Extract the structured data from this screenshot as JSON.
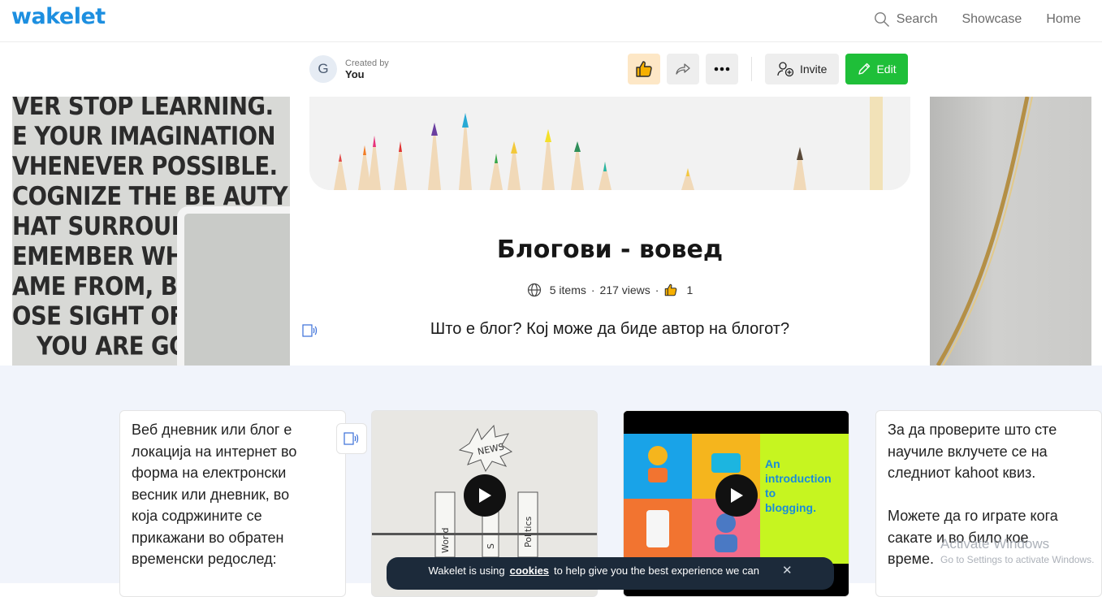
{
  "brand": {
    "logo": "wakelet",
    "color": "#1d8fe0"
  },
  "nav": {
    "search": "Search",
    "showcase": "Showcase",
    "home": "Home"
  },
  "creator": {
    "initial": "G",
    "created_by": "Created by",
    "name": "You"
  },
  "actions": {
    "invite": "Invite",
    "edit": "Edit",
    "edit_color": "#1fbf39"
  },
  "cover_left_lines": [
    "VER STOP LEARNING.",
    "E YOUR IMAGINATION",
    "VHENEVER POSSIBLE.",
    "COGNIZE THE BE AUTY",
    "HAT SURROUN",
    "EMEMBER WHI",
    "AME FROM, BU",
    "OSE SIGHT OF",
    "YOU ARE GO"
  ],
  "collection": {
    "title": "Блогови - вовед",
    "items": "5 items",
    "views": "217 views",
    "likes": "1",
    "description": "Што е блог? Кој може да биде автор на блогот?"
  },
  "cards": {
    "text1_lines": [
      "Веб дневник или блог е",
      "локација на интернет во",
      "форма на електронски",
      "весник или дневник, во",
      "која содржините се",
      "прикажани во обратен",
      "временски редослед:"
    ],
    "video1_labels": [
      "NEWS",
      "World",
      "S",
      "Politics"
    ],
    "video2_caption": [
      "An",
      "introduction",
      "to",
      "blogging."
    ],
    "text2_lines": [
      "За да проверите што сте",
      "научиле вклучете се на",
      "следниот kahoot квиз.",
      "",
      "Можете да го играте кога",
      "сакате и во било кое",
      "време."
    ]
  },
  "cookie": {
    "prefix": "Wakelet is using",
    "link": "cookies",
    "suffix": "to help give you the best experience we can",
    "close": "✕"
  },
  "watermark": {
    "line1": "Activate Windows",
    "line2": "Go to Settings to activate Windows."
  }
}
